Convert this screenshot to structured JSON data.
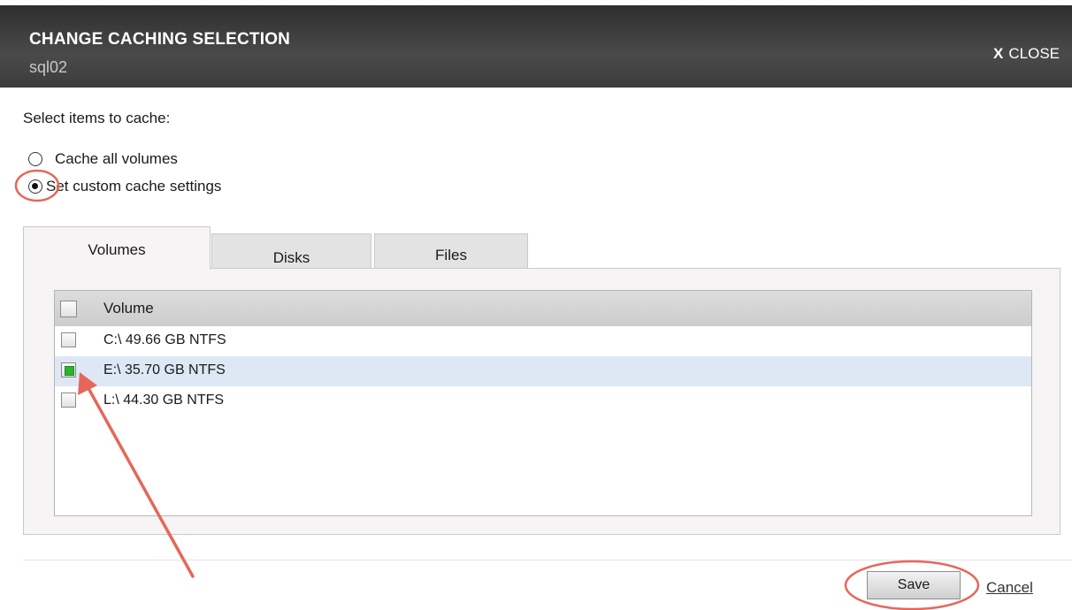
{
  "dialog": {
    "title": "CHANGE CACHING SELECTION",
    "subtitle": "sql02",
    "close_x": "X",
    "close_label": "CLOSE"
  },
  "selection": {
    "prompt": "Select items to cache:",
    "options": [
      {
        "label": "Cache all volumes",
        "checked": false
      },
      {
        "label": "Set custom cache settings",
        "checked": true
      }
    ]
  },
  "tabs": [
    {
      "label": "Volumes",
      "active": true
    },
    {
      "label": "Disks",
      "active": false
    },
    {
      "label": "Files",
      "active": false
    }
  ],
  "volumes_table": {
    "column": "Volume",
    "rows": [
      {
        "label": "C:\\ 49.66 GB NTFS",
        "checked": false
      },
      {
        "label": "E:\\ 35.70 GB NTFS",
        "checked": true
      },
      {
        "label": "L:\\ 44.30 GB NTFS",
        "checked": false
      }
    ]
  },
  "actions": {
    "save_label": "Save",
    "cancel_label": "Cancel"
  },
  "annotation_color": "#e5675a"
}
